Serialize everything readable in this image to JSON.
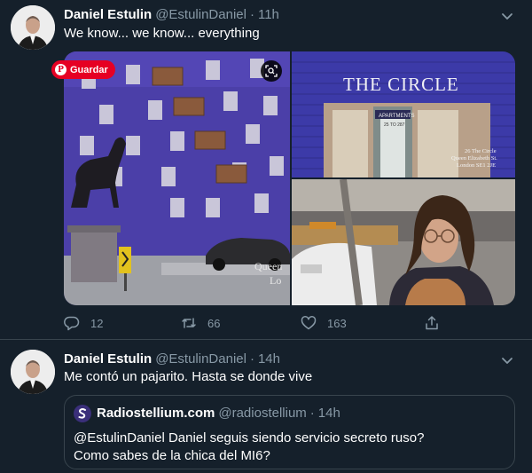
{
  "tweets": [
    {
      "name": "Daniel Estulin",
      "handle": "@EstulinDaniel",
      "separator": "·",
      "time": "11h",
      "text": "We know... we know... everything",
      "media": {
        "pin_button": "Guardar",
        "sign_text": "THE CIRCLE",
        "sign_small": "APARTMENTS",
        "sign_number": "25 TO 287",
        "caption_lines": [
          "26 The Circle",
          "Queen Elizabeth St.",
          "London SE1 2JE"
        ],
        "overlay_left": [
          "Queen",
          "Lo"
        ]
      },
      "actions": {
        "replies": "12",
        "retweets": "66",
        "likes": "163"
      }
    },
    {
      "name": "Daniel Estulin",
      "handle": "@EstulinDaniel",
      "separator": "·",
      "time": "14h",
      "text": "Me contó un pajarito. Hasta se donde vive",
      "quote": {
        "name": "Radiostellium.com",
        "handle": "@radiostellium",
        "separator": "·",
        "time": "14h",
        "lines": [
          "@EstulinDaniel Daniel seguis siendo servicio secreto ruso?",
          "Como sabes de la chica del MI6?"
        ]
      }
    }
  ],
  "colors": {
    "background": "#15202b",
    "secondary_text": "#8899a6",
    "border": "#38444d",
    "pinterest": "#e60023"
  },
  "icons": [
    "caret-down-icon",
    "reply-icon",
    "retweet-icon",
    "like-icon",
    "share-icon",
    "lens-icon",
    "pinterest-icon"
  ]
}
